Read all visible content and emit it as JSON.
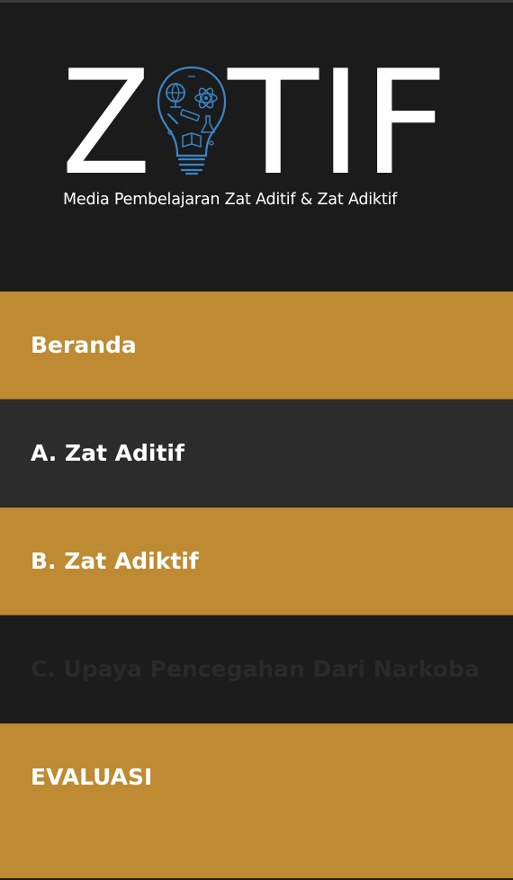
{
  "header": {
    "logo_text_left": "Z",
    "logo_text_right": "TIF",
    "logo_icon": "lightbulb-science-icon",
    "tagline": "Media Pembelajaran Zat Aditif & Zat Adiktif"
  },
  "menu": {
    "items": [
      {
        "label": "Beranda",
        "style": "gold"
      },
      {
        "label": "A. Zat Aditif",
        "style": "dark"
      },
      {
        "label": "B. Zat Adiktif",
        "style": "gold"
      },
      {
        "label": "C. Upaya Pencegahan Dari Narkoba",
        "style": "black"
      },
      {
        "label": "EVALUASI",
        "style": "gold"
      }
    ]
  },
  "colors": {
    "background": "#1b1b1b",
    "gold": "#be8a32",
    "dark_item": "#2c2c2c",
    "logo_blue": "#3a86c8",
    "text": "#ffffff"
  }
}
